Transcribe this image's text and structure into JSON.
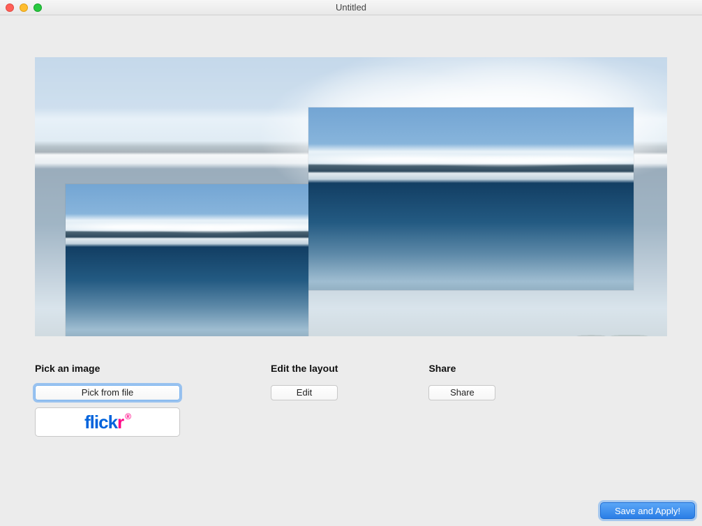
{
  "window": {
    "title": "Untitled"
  },
  "sections": {
    "pick": {
      "heading": "Pick an image",
      "pick_file_label": "Pick from file",
      "flickr_label": "flickr"
    },
    "edit": {
      "heading": "Edit the layout",
      "edit_label": "Edit"
    },
    "share": {
      "heading": "Share",
      "share_label": "Share"
    }
  },
  "footer": {
    "save_apply_label": "Save and Apply!"
  },
  "icons": {
    "traffic_close": "close-icon",
    "traffic_min": "minimize-icon",
    "traffic_max": "zoom-icon"
  }
}
